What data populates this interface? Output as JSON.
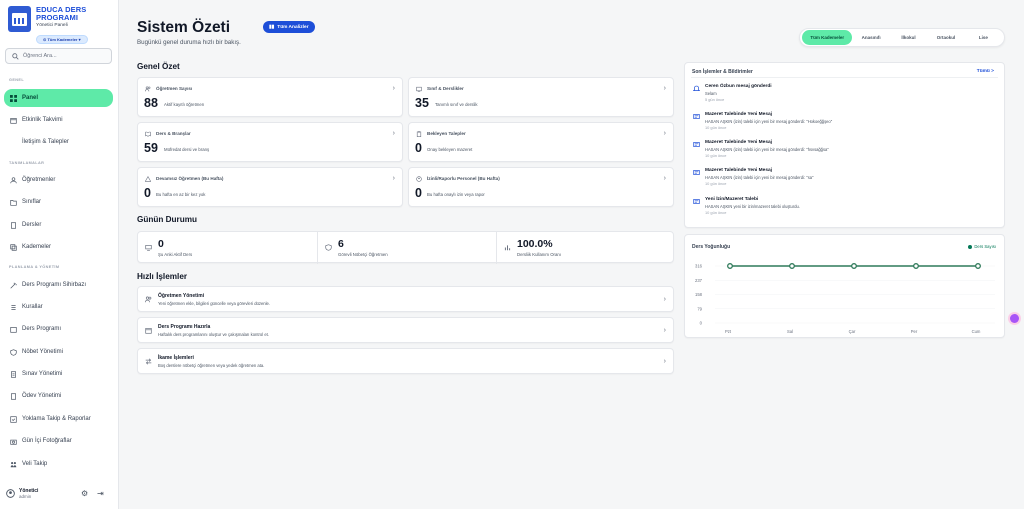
{
  "brand": {
    "name_line1": "EDUCA DERS",
    "name_line2": "PROGRAMI",
    "subtitle": "Yönetici Paneli",
    "kademe_pill": "Tüm Kademeler"
  },
  "search": {
    "placeholder": "Öğrenci Ara..."
  },
  "sidebar": {
    "sections": {
      "genel": "GENEL",
      "tanimlamalar": "TANIMLAMALAR",
      "planlama": "PLANLAMA & YÖNETİM"
    },
    "items": [
      {
        "label": "Panel",
        "icon": "grid-icon"
      },
      {
        "label": "Etkinlik Takvimi",
        "icon": "calendar-icon"
      },
      {
        "label": "İletişim & Talepler",
        "icon": "mail-icon"
      },
      {
        "label": "Öğretmenler",
        "icon": "user-icon"
      },
      {
        "label": "Sınıflar",
        "icon": "folder-icon"
      },
      {
        "label": "Dersler",
        "icon": "book-icon"
      },
      {
        "label": "Kademeler",
        "icon": "layers-icon"
      },
      {
        "label": "Ders Programı Sihirbazı",
        "icon": "wand-icon"
      },
      {
        "label": "Kurallar",
        "icon": "rules-icon"
      },
      {
        "label": "Ders Programı",
        "icon": "schedule-icon"
      },
      {
        "label": "Nöbet Yönetimi",
        "icon": "shield-icon"
      },
      {
        "label": "Sınav Yönetimi",
        "icon": "exam-icon"
      },
      {
        "label": "Ödev Yönetimi",
        "icon": "homework-icon"
      },
      {
        "label": "Yoklama Takip & Raporlar",
        "icon": "attendance-icon"
      },
      {
        "label": "Gün İçi Fotoğraflar",
        "icon": "camera-icon"
      },
      {
        "label": "Veli Takip",
        "icon": "parents-icon"
      }
    ],
    "user": {
      "name": "Yönetici",
      "role": "admin"
    }
  },
  "header": {
    "title": "Sistem Özeti",
    "subtitle": "Bugünkü genel duruma hızlı bir bakış.",
    "analyze_button": "Tüm Analizler",
    "tabs": [
      "Tüm Kademeler",
      "Anasınıfı",
      "İlkokul",
      "Ortaokul",
      "Lise"
    ]
  },
  "overview": {
    "heading": "Genel Özet",
    "stats": [
      {
        "label": "Öğretmen Sayısı",
        "value": "88",
        "desc": "Aktif kayıtlı öğretmen"
      },
      {
        "label": "Sınıf & Derslikler",
        "value": "35",
        "desc": "Tanımlı sınıf ve derslik"
      },
      {
        "label": "Ders & Branşlar",
        "value": "59",
        "desc": "Müfredat dersi ve branş"
      },
      {
        "label": "Bekleyen Talepler",
        "value": "0",
        "desc": "Onay bekleyen mazeret"
      },
      {
        "label": "Devamsız Öğretmen (Bu Hafta)",
        "value": "0",
        "desc": "Bu hafta en az bir kez yok"
      },
      {
        "label": "İzinli/Raporlu Personel (Bu Hafta)",
        "value": "0",
        "desc": "Bu hafta onaylı izin veya rapor"
      }
    ]
  },
  "today": {
    "heading": "Günün Durumu",
    "items": [
      {
        "value": "0",
        "label": "Şu Anki Aktif Ders"
      },
      {
        "value": "6",
        "label": "Görevli Nöbetçi Öğretmen"
      },
      {
        "value": "100.0%",
        "label": "Dersliik Kullanım Oranı"
      }
    ]
  },
  "quick": {
    "heading": "Hızlı İşlemler",
    "items": [
      {
        "title": "Öğretmen Yönetimi",
        "desc": "Yeni öğretmen ekle, bilgileri güncelle veya görevleri düzenle."
      },
      {
        "title": "Ders Programı Hazırla",
        "desc": "Haftalık ders programlarını oluştur ve çakışmaları kontrol et."
      },
      {
        "title": "İkame İşlemleri",
        "desc": "Boş derslere nöbetçi öğretmen veya yedek öğretmen ata."
      }
    ]
  },
  "activity": {
    "heading": "Son İşlemler & Bildirimler",
    "see_all": "Tümü >",
    "items": [
      {
        "title": "Ceren Özbun mesaj gönderdi",
        "desc": "Selam",
        "time": "5 gün önce"
      },
      {
        "title": "Mazeret Talebinde Yeni Mesaj",
        "desc": "HASAN AŞKIN (izin) talebi için yeni bir mesaj gönderdi: \"Hokoeğğşeo\"",
        "time": "10 gün önce"
      },
      {
        "title": "Mazeret Talebinde Yeni Mesaj",
        "desc": "HASAN AŞKIN (izin) talebi için yeni bir mesaj gönderdi: \"hsvsağğsa\"",
        "time": "10 gün önce"
      },
      {
        "title": "Mazeret Talebinde Yeni Mesaj",
        "desc": "HASAN AŞKIN (izin) talebi için yeni bir mesaj gönderdi: \"sa\"",
        "time": "10 gün önce"
      },
      {
        "title": "Yeni İzin/Mazeret Talebi",
        "desc": "HASAN AŞKIN yeni bir izin/mazeret talebi oluşturdu.",
        "time": "10 gün önce"
      }
    ]
  },
  "chart_data": {
    "type": "line",
    "title": "Ders Yoğunluğu",
    "series": [
      {
        "name": "Ders Sayısı",
        "values": [
          316,
          316,
          316,
          316,
          316
        ]
      }
    ],
    "categories": [
      "Pzt",
      "Sal",
      "Çar",
      "Per",
      "Cum"
    ],
    "y_ticks": [
      "316",
      "237",
      "158",
      "79",
      "0"
    ],
    "ylim": [
      0,
      316
    ],
    "color": "#2f7a5a"
  }
}
